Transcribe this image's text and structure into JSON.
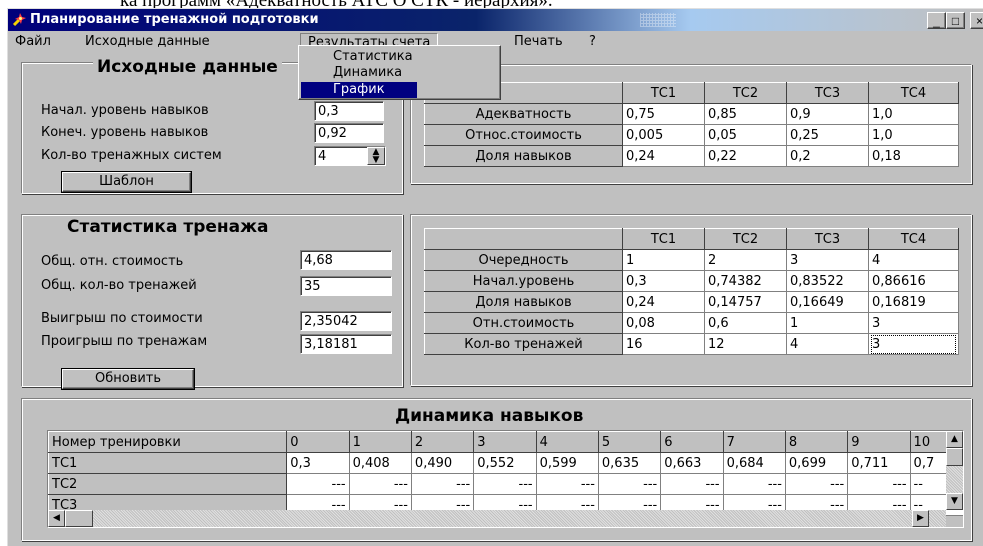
{
  "caption_above": "ка программ «Адекватность АТС О СТК - иерархия».",
  "window": {
    "title": "Планирование тренажной подготовки",
    "controls": {
      "minimize": "_",
      "maximize": "□",
      "close": "×"
    }
  },
  "menu": {
    "items": [
      "Файл",
      "Исходные данные",
      "Результаты счета",
      "Печать",
      "?"
    ],
    "open_index": 2,
    "dropdown": [
      "Статистика",
      "Динамика",
      "График"
    ],
    "dropdown_selected": 2
  },
  "input_group": {
    "title": "Исходные данные",
    "fields": [
      {
        "label": "Начал. уровень навыков",
        "value": "0,3"
      },
      {
        "label": "Конеч. уровень навыков",
        "value": "0,92"
      },
      {
        "label": "Кол-во тренажных систем",
        "value": "4"
      }
    ],
    "template_button": "Шаблон",
    "table": {
      "headers": [
        "",
        "ТС1",
        "ТС2",
        "ТС3",
        "ТС4"
      ],
      "rows": [
        [
          "Адекватность",
          "0,75",
          "0,85",
          "0,9",
          "1,0"
        ],
        [
          "Относ.стоимость",
          "0,005",
          "0,05",
          "0,25",
          "1,0"
        ],
        [
          "Доля навыков",
          "0,24",
          "0,22",
          "0,2",
          "0,18"
        ]
      ]
    }
  },
  "stats_group": {
    "title": "Статистика тренажа",
    "fields": [
      {
        "label": "Общ. отн. стоимость",
        "value": "4,68"
      },
      {
        "label": "Общ. кол-во тренажей",
        "value": "35"
      },
      {
        "label": "Выигрыш по стоимости",
        "value": "2,35042"
      },
      {
        "label": "Проигрыш по тренажам",
        "value": "3,18181"
      }
    ],
    "refresh_button": "Обновить",
    "table": {
      "headers": [
        "",
        "ТС1",
        "ТС2",
        "ТС3",
        "ТС4"
      ],
      "rows": [
        [
          "Очередность",
          "1",
          "2",
          "3",
          "4"
        ],
        [
          "Начал.уровень",
          "0,3",
          "0,74382",
          "0,83522",
          "0,86616"
        ],
        [
          "Доля навыков",
          "0,24",
          "0,14757",
          "0,16649",
          "0,16819"
        ],
        [
          "Отн.стоимость",
          "0,08",
          "0,6",
          "1",
          "3"
        ],
        [
          "Кол-во тренажей",
          "16",
          "12",
          "4",
          "3"
        ]
      ]
    }
  },
  "dynamics_group": {
    "title": "Динамика навыков",
    "table": {
      "headers": [
        "Номер тренировки",
        "0",
        "1",
        "2",
        "3",
        "4",
        "5",
        "6",
        "7",
        "8",
        "9",
        "10"
      ],
      "rows": [
        [
          "ТС1",
          "0,3",
          "0,408",
          "0,490",
          "0,552",
          "0,599",
          "0,635",
          "0,663",
          "0,684",
          "0,699",
          "0,711",
          "0,7"
        ],
        [
          "ТС2",
          "---",
          "---",
          "---",
          "---",
          "---",
          "---",
          "---",
          "---",
          "---",
          "---",
          "--"
        ],
        [
          "ТС3",
          "---",
          "---",
          "---",
          "---",
          "---",
          "---",
          "---",
          "---",
          "---",
          "---",
          "--"
        ]
      ]
    }
  }
}
